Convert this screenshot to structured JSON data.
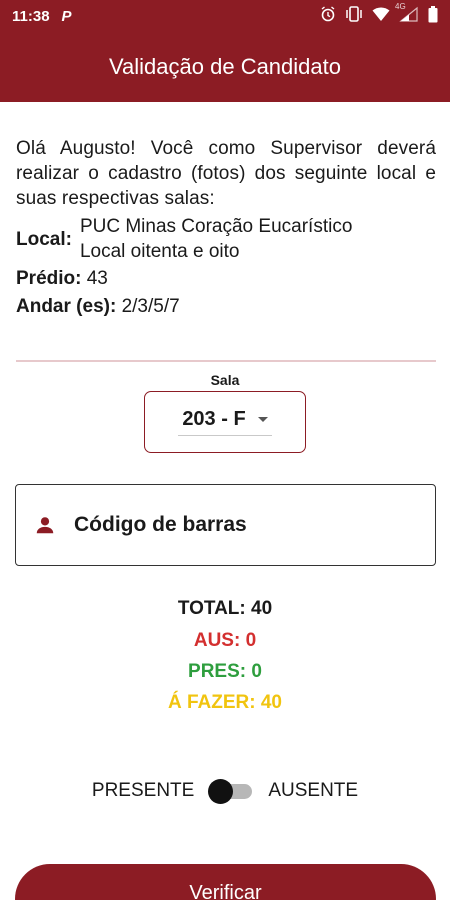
{
  "status_bar": {
    "time": "11:38",
    "app_icon": "P",
    "network": "4G",
    "icons": [
      "alarm-icon",
      "vibrate-icon",
      "wifi-icon",
      "signal-icon",
      "battery-icon"
    ]
  },
  "app_bar": {
    "title": "Validação de Candidato"
  },
  "intro": {
    "text": "Olá Augusto! Você como Supervisor deverá realizar o cadastro (fotos) dos seguinte local e suas respectivas salas:"
  },
  "info": {
    "local_label": "Local:",
    "local_line1": "PUC Minas Coração Eucarístico",
    "local_line2": "Local oitenta e oito",
    "predio_label": "Prédio:",
    "predio_value": "43",
    "andar_label": "Andar (es):",
    "andar_value": "2/3/5/7"
  },
  "sala": {
    "label": "Sala",
    "selected": "203 - F"
  },
  "barcode": {
    "placeholder": "Código de barras"
  },
  "counters": {
    "total": "TOTAL: 40",
    "aus": "AUS: 0",
    "pres": "PRES: 0",
    "fazer": "Á FAZER: 40"
  },
  "toggle": {
    "left_label": "PRESENTE",
    "right_label": "AUSENTE",
    "state": "presente"
  },
  "verify_button": {
    "label": "Verificar"
  },
  "colors": {
    "brand": "#8c1c24",
    "aus": "#d32f2f",
    "pres": "#2e9e3e",
    "fazer": "#f1c40f"
  }
}
